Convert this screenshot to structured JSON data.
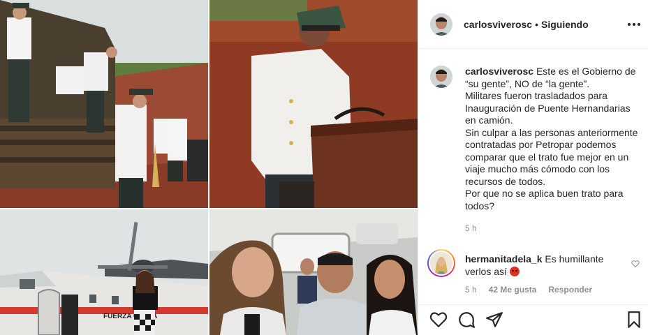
{
  "post": {
    "username": "carlosviverosc",
    "separator": "•",
    "follow_status": "Siguiendo",
    "more_icon": "more-options-icon"
  },
  "caption": {
    "username": "carlosviverosc",
    "text": "Este es el Gobierno de “su gente”, NO de “la gente”.\nMilitares fueron trasladados para Inauguración de Puente Hernandarias en camión.\nSin culpar a las personas anteriormente contratadas por Petropar podemos comparar que el trato fue mejor en un viaje mucho más cómodo con los recursos de todos.\nPor que no se aplica buen trato para todos?",
    "time": "5 h"
  },
  "comment": {
    "username": "hermanitadela_k",
    "text": "Es humillante verlos así",
    "emoji": "angry-face-emoji",
    "time": "5 h",
    "likes": "42 Me gusta",
    "reply": "Responder"
  },
  "photos": {
    "plane_text": "FUERZA          GUAYA"
  },
  "actions": [
    "heart-icon",
    "comment-icon",
    "share-icon",
    "bookmark-icon"
  ],
  "colors": {
    "text": "#262626",
    "secondary": "#8e8e8e",
    "divider": "#efefef",
    "angry_emoji": "#e0301e"
  }
}
